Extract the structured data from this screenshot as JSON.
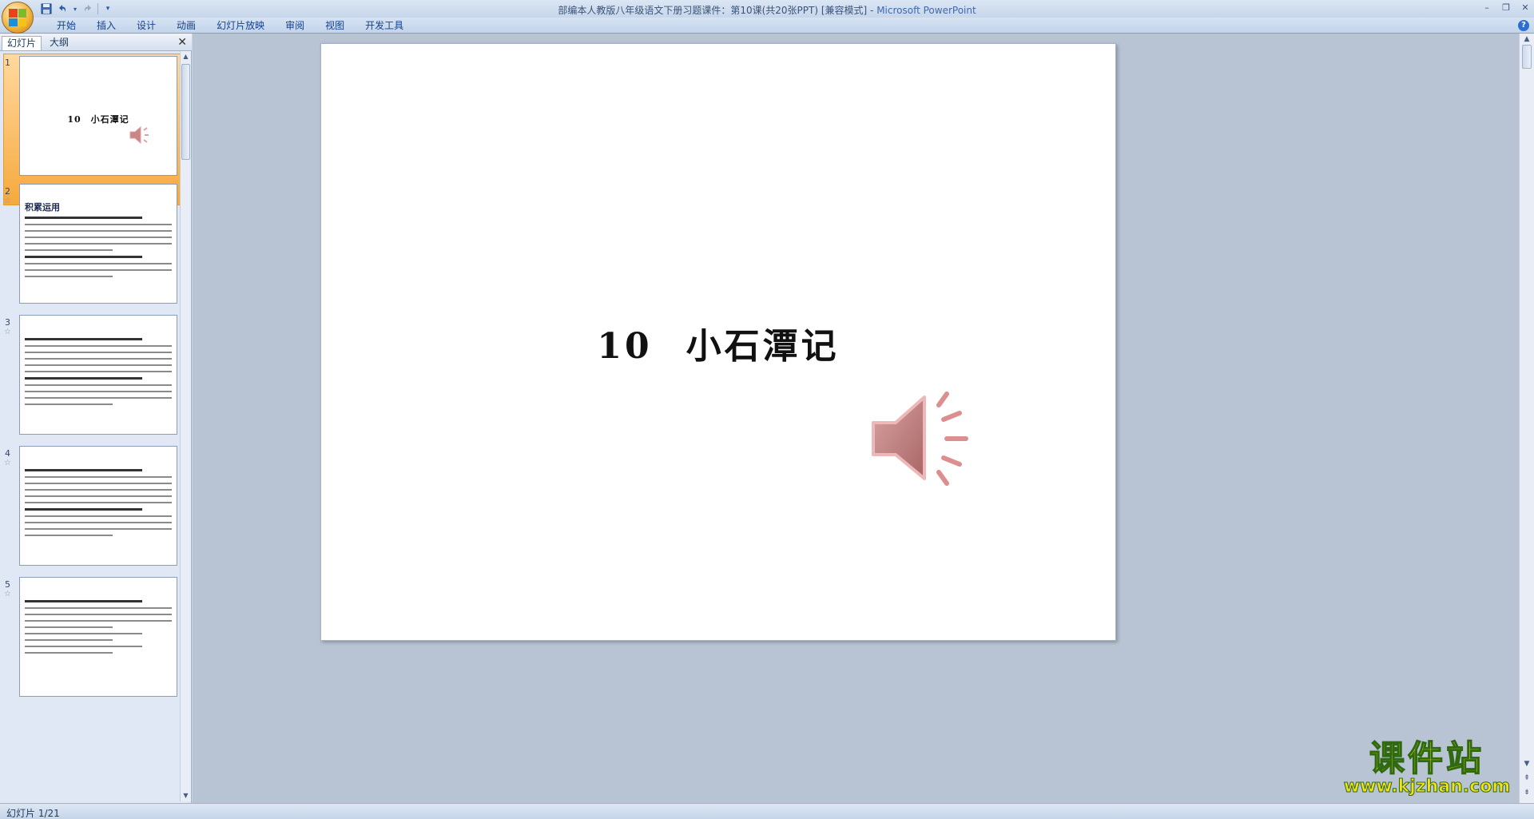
{
  "window": {
    "title": "部编本人教版八年级语文下册习题课件：第10课(共20张PPT) [兼容模式]",
    "app_name": "Microsoft PowerPoint"
  },
  "ribbon": {
    "tabs": [
      "开始",
      "插入",
      "设计",
      "动画",
      "幻灯片放映",
      "审阅",
      "视图",
      "开发工具"
    ]
  },
  "left_panel": {
    "tab_slides": "幻灯片",
    "tab_outline": "大纲",
    "thumbnails": [
      {
        "number": "1",
        "title": "10　小石潭记"
      },
      {
        "number": "2",
        "heading": "积累运用"
      },
      {
        "number": "3"
      },
      {
        "number": "4"
      },
      {
        "number": "5"
      }
    ]
  },
  "slide": {
    "number_text": "10",
    "title_text": "小石潭记"
  },
  "status": {
    "slide_counter": "幻灯片 1/21"
  },
  "watermark": {
    "cn": "课件站",
    "url": "www.kjzhan.com"
  },
  "icons": {
    "sound": "speaker-icon",
    "save": "save-icon",
    "undo": "undo-icon",
    "redo": "redo-icon"
  }
}
